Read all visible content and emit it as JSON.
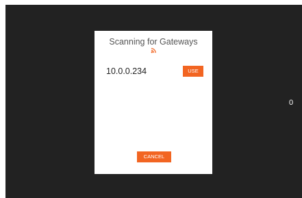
{
  "side_value": "0",
  "dialog": {
    "title": "Scanning for Gateways",
    "icon": "wifi-scan-icon",
    "gateways": [
      {
        "ip": "10.0.0.234",
        "action_label": "USE"
      }
    ],
    "cancel_label": "CANCEL"
  },
  "colors": {
    "background": "#222222",
    "dialog_bg": "#ffffff",
    "accent": "#f26522"
  }
}
